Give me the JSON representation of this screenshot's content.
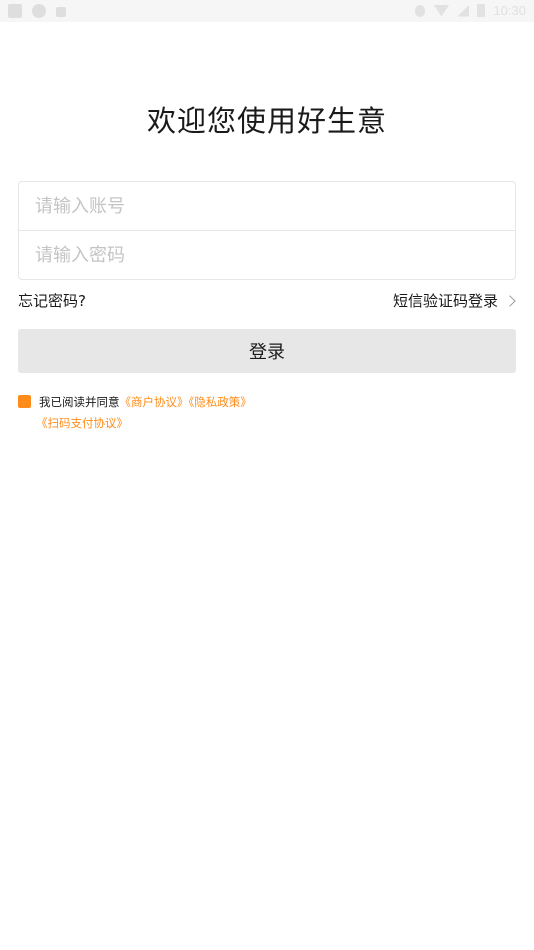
{
  "status_bar": {
    "time": "10:30"
  },
  "title": "欢迎您使用好生意",
  "form": {
    "account_placeholder": "请输入账号",
    "password_placeholder": "请输入密码"
  },
  "links": {
    "forgot_password": "忘记密码?",
    "sms_login": "短信验证码登录"
  },
  "login_button": "登录",
  "agreement": {
    "prefix": "我已阅读并同意",
    "merchant_agreement": "《商户协议》",
    "privacy_policy": "《隐私政策》",
    "scan_pay_agreement": "《扫码支付协议》",
    "accent_color": "#ff8c1a"
  }
}
